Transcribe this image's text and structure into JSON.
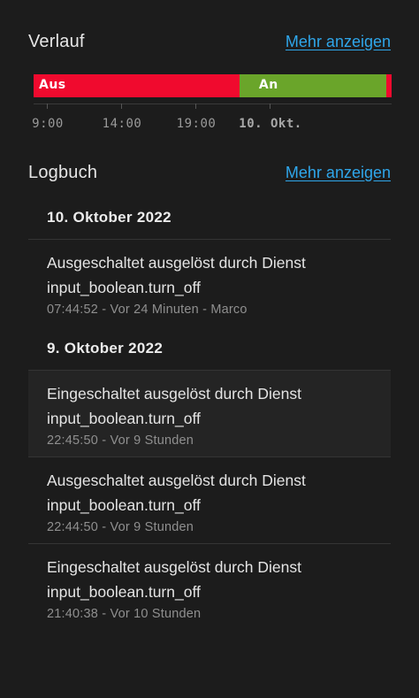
{
  "history": {
    "title": "Verlauf",
    "more_link": "Mehr anzeigen",
    "timeline": {
      "segments": [
        {
          "label": "Aus",
          "state": "off",
          "fraction": 0.575
        },
        {
          "label": "An",
          "state": "on",
          "fraction": 0.41
        },
        {
          "label": "",
          "state": "off",
          "fraction": 0.015
        }
      ],
      "ticks": [
        "9:00",
        "14:00",
        "19:00",
        "10. Okt."
      ],
      "colors": {
        "off": "#f00a2e",
        "on": "#6aa52a"
      }
    }
  },
  "logbook": {
    "title": "Logbuch",
    "more_link": "Mehr anzeigen",
    "days": [
      {
        "date": "10. Oktober 2022",
        "entries": [
          {
            "line1": "Ausgeschaltet ausgelöst durch Dienst",
            "line2": "input_boolean.turn_off",
            "meta": "07:44:52 - Vor 24 Minuten - Marco"
          }
        ]
      },
      {
        "date": "9. Oktober 2022",
        "entries": [
          {
            "line1": "Eingeschaltet ausgelöst durch Dienst",
            "line2": "input_boolean.turn_off",
            "meta": "22:45:50 - Vor 9 Stunden"
          },
          {
            "line1": "Ausgeschaltet ausgelöst durch Dienst",
            "line2": "input_boolean.turn_off",
            "meta": "22:44:50 - Vor 9 Stunden"
          },
          {
            "line1": "Eingeschaltet ausgelöst durch Dienst",
            "line2": "input_boolean.turn_off",
            "meta": "21:40:38 - Vor 10 Stunden"
          }
        ]
      }
    ]
  }
}
